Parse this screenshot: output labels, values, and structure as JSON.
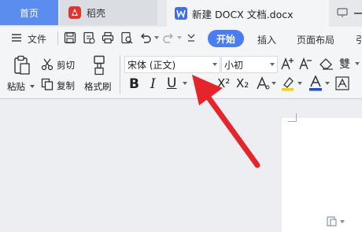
{
  "tabs": {
    "home": "首页",
    "daoke": "稻壳",
    "doc": "新建 DOCX 文档.docx"
  },
  "menu": {
    "file": "文件",
    "start": "开始",
    "insert": "插入",
    "layout": "页面布局",
    "more": "引"
  },
  "ribbon": {
    "paste": "粘贴",
    "cut": "剪切",
    "copy": "复制",
    "format_painter": "格式刷",
    "font_name": "宋体 (正文)",
    "font_size": "小初",
    "bold": "B",
    "italic": "I",
    "underline": "U",
    "superscript": "X²",
    "subscript": "X₂",
    "phonetic": "雙"
  },
  "colors": {
    "accent": "#4a7cf3",
    "home_tab": "#5b8def",
    "arrow": "#e5252a",
    "highlight": "#f5d10a",
    "font_color": "#1f4fd8"
  }
}
